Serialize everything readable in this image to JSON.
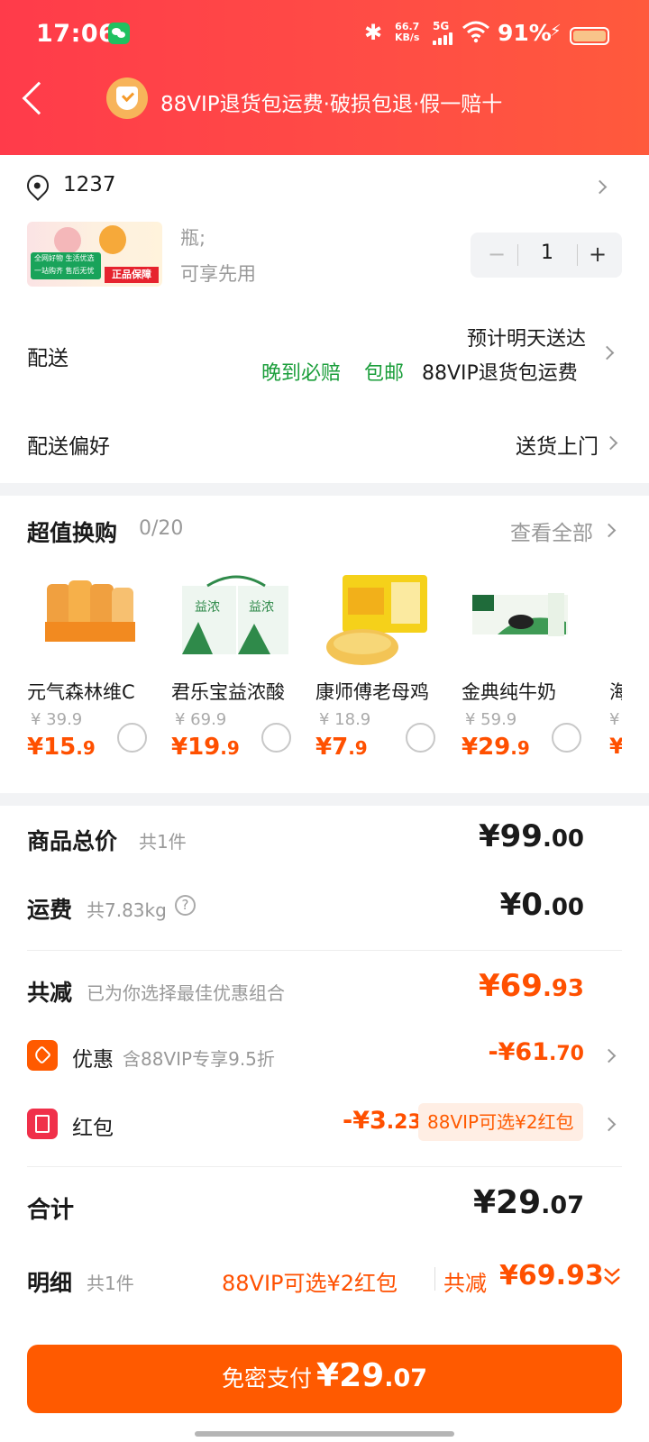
{
  "status_bar": {
    "time": "17:06",
    "net_speed_top": "66.7",
    "net_speed_unit": "KB/s",
    "network": "5G",
    "battery": "91%"
  },
  "header": {
    "title": "88VIP退货包运费·破损包退·假一赔十"
  },
  "address": {
    "text": "1237"
  },
  "product": {
    "spec": "瓶;",
    "note": "可享先用",
    "quantity": "1",
    "img_banner": "全网好物 生活优选",
    "img_banner2": "一站购齐 售后无忧",
    "img_tag": "正品保障"
  },
  "delivery": {
    "label": "配送",
    "eta": "预计明天送达",
    "tag_late": "晚到必赔",
    "tag_free": "包邮",
    "tag_vip": "88VIP退货包运费",
    "pref_label": "配送偏好",
    "pref_value": "送货上门"
  },
  "deals": {
    "title": "超值换购",
    "count": "0/20",
    "view_all": "查看全部",
    "items": [
      {
        "name": "元气森林维C",
        "orig": "¥ 39.9",
        "price_int": "¥15",
        "price_dec": ".9"
      },
      {
        "name": "君乐宝益浓酸",
        "orig": "¥ 69.9",
        "price_int": "¥19",
        "price_dec": ".9"
      },
      {
        "name": "康师傅老母鸡",
        "orig": "¥ 18.9",
        "price_int": "¥7",
        "price_dec": ".9"
      },
      {
        "name": "金典纯牛奶",
        "orig": "¥ 59.9",
        "price_int": "¥29",
        "price_dec": ".9"
      }
    ],
    "partial_name": "海",
    "partial_orig": "¥",
    "partial_price": "¥"
  },
  "summary": {
    "goods_label": "商品总价",
    "goods_count": "共1件",
    "goods_int": "¥99",
    "goods_dec": ".00",
    "ship_label": "运费",
    "ship_weight": "共7.83kg",
    "ship_int": "¥0",
    "ship_dec": ".00",
    "reduce_label": "共减",
    "reduce_note": "已为你选择最佳优惠组合",
    "reduce_int": "¥69",
    "reduce_dec": ".93",
    "discount_label": "优惠",
    "discount_note": "含88VIP专享9.5折",
    "discount_int": "-¥61",
    "discount_dec": ".70",
    "redpack_label": "红包",
    "redpack_int": "-¥3",
    "redpack_dec": ".23",
    "redpack_tag": "88VIP可选¥2红包",
    "total_label": "合计",
    "total_int": "¥29",
    "total_dec": ".07",
    "detail_label": "明细",
    "detail_count": "共1件",
    "detail_vip": "88VIP可选¥2红包",
    "detail_reduce_label": "共减",
    "detail_reduce_value": "¥69.93"
  },
  "pay": {
    "label": "免密支付",
    "int": "¥29",
    "dec": ".07"
  },
  "colors": {
    "header": "#ff3b4a",
    "accent": "#ff5000",
    "pay_button": "#ff5a00",
    "green_tag": "#1a9e3a"
  }
}
